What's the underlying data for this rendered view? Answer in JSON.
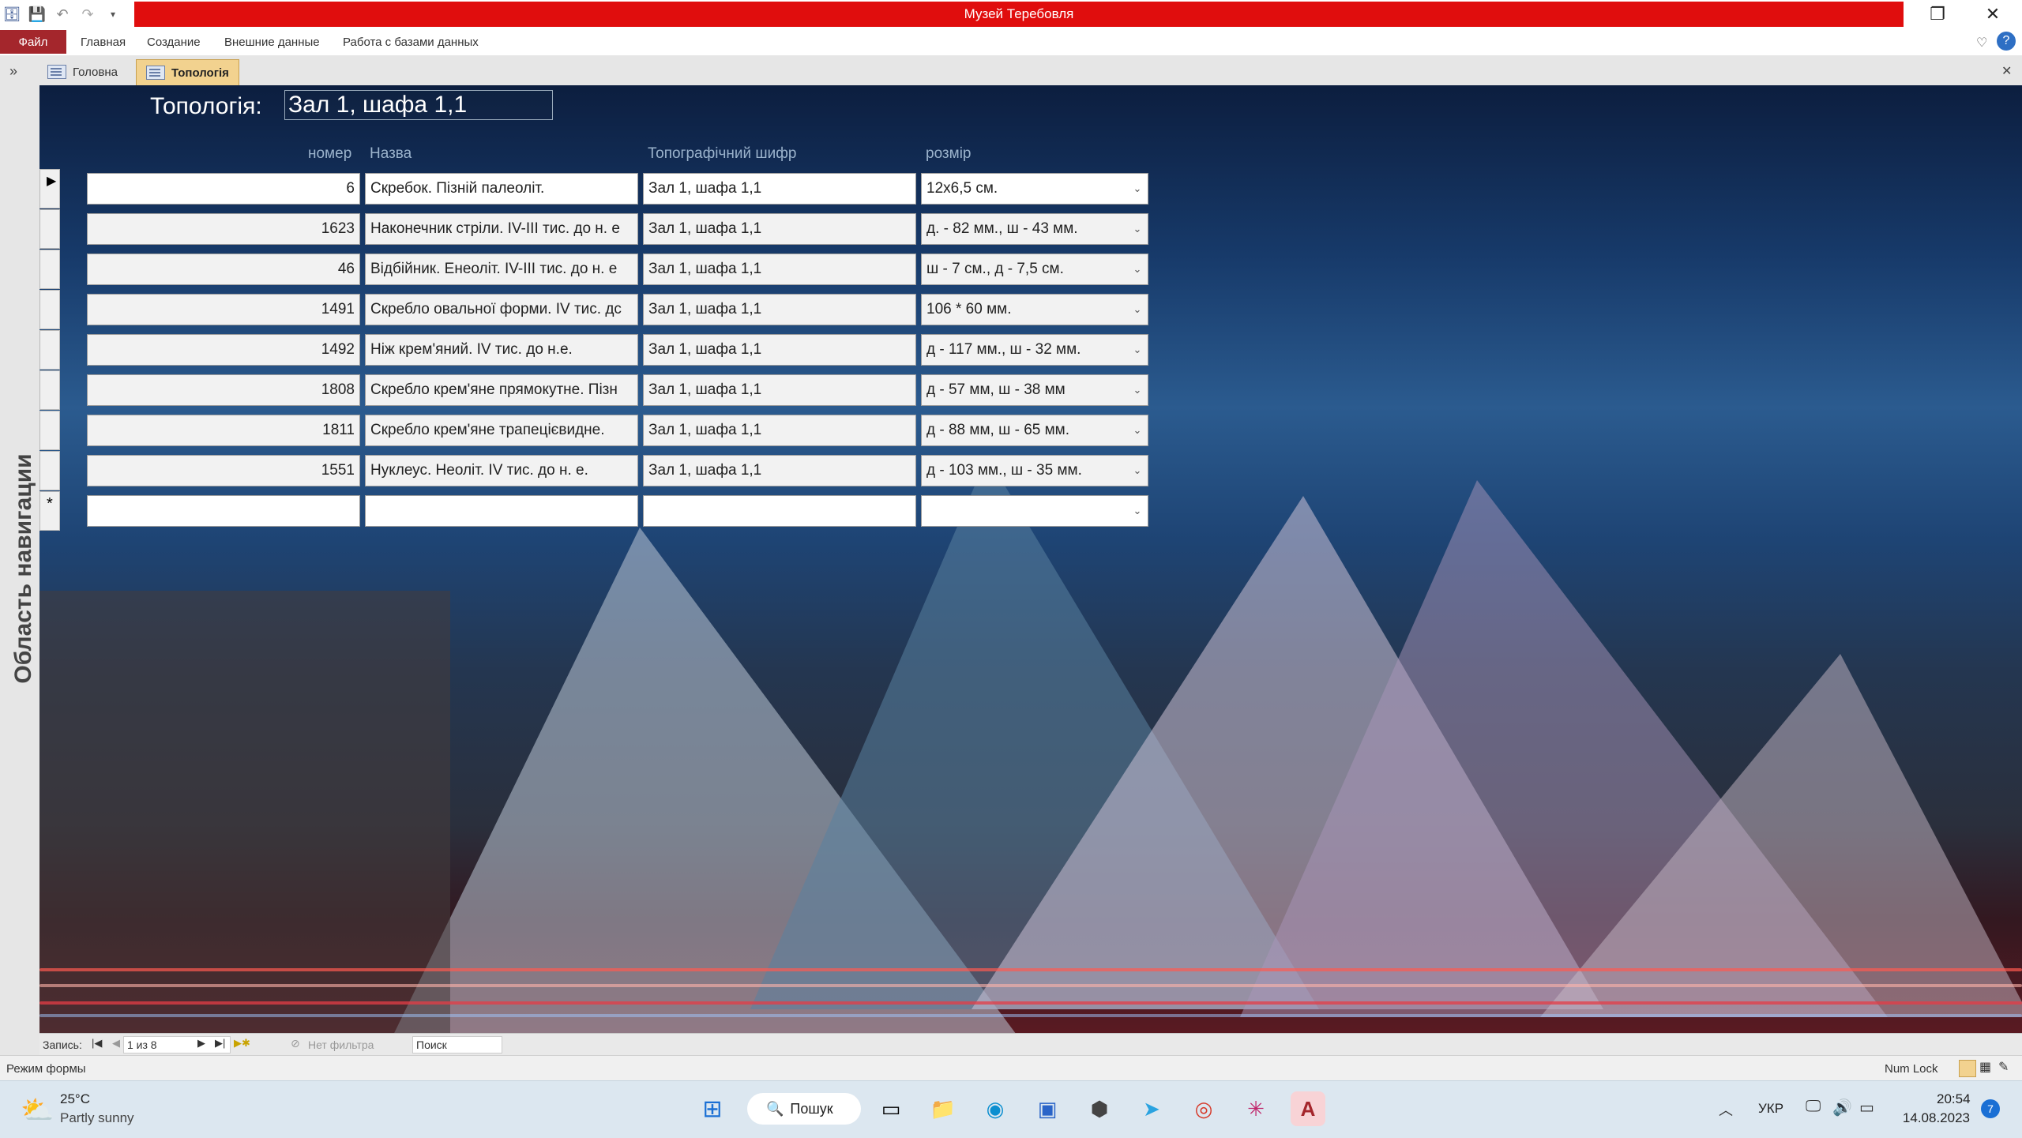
{
  "window": {
    "title": "Музей Теребовля",
    "ribbon_tabs": [
      "Файл",
      "Главная",
      "Создание",
      "Внешние данные",
      "Работа с базами данных"
    ],
    "doc_tabs": [
      "Головна",
      "Топологія"
    ],
    "active_doc_tab": "Топологія"
  },
  "nav_pane": {
    "label": "Область навигации",
    "toggle": "»"
  },
  "form": {
    "title_label": "Топологія:",
    "title_value": "Зал 1, шафа 1,1",
    "columns": [
      "номер",
      "Назва",
      "Топографічний шифр",
      "розмір"
    ],
    "rows": [
      [
        "6",
        "Скребок. Пізній палеоліт.",
        "Зал 1, шафа 1,1",
        "12x6,5 см."
      ],
      [
        "1623",
        "Наконечник стріли. IV-III тис. до н. е",
        "Зал 1, шафа 1,1",
        "д. - 82 мм., ш - 43 мм."
      ],
      [
        "46",
        "Відбійник. Енеоліт. IV-III тис. до н. е",
        "Зал 1, шафа 1,1",
        "ш - 7 см., д - 7,5 см."
      ],
      [
        "1491",
        "Скребло овальної форми. IV тис. дс",
        "Зал 1, шафа 1,1",
        "106 * 60 мм."
      ],
      [
        "1492",
        "Ніж крем'яний. IV тис. до н.е.",
        "Зал 1, шафа 1,1",
        "д - 117 мм., ш - 32 мм."
      ],
      [
        "1808",
        "Скребло крем'яне прямокутне. Пізн",
        "Зал 1, шафа 1,1",
        "д - 57 мм, ш - 38 мм"
      ],
      [
        "1811",
        "Скребло крем'яне трапецієвидне.",
        "Зал 1, шафа 1,1",
        "д - 88 мм, ш - 65 мм."
      ],
      [
        "1551",
        "Нуклеус. Неоліт. IV тис. до н. е.",
        "Зал 1, шафа 1,1",
        "д - 103 мм., ш - 35 мм."
      ]
    ],
    "new_row_marker": "*",
    "current_row_marker": "▶"
  },
  "record_nav": {
    "label": "Запись:",
    "position": "1 из 8",
    "filter": "Нет фильтра",
    "search_placeholder": "Поиск"
  },
  "status_bar": {
    "mode": "Режим формы",
    "num_lock": "Num Lock"
  },
  "taskbar": {
    "weather_temp": "25°C",
    "weather_desc": "Partly sunny",
    "search_label": "Пошук",
    "language": "УКР",
    "time": "20:54",
    "date": "14.08.2023",
    "notification_count": "7"
  }
}
